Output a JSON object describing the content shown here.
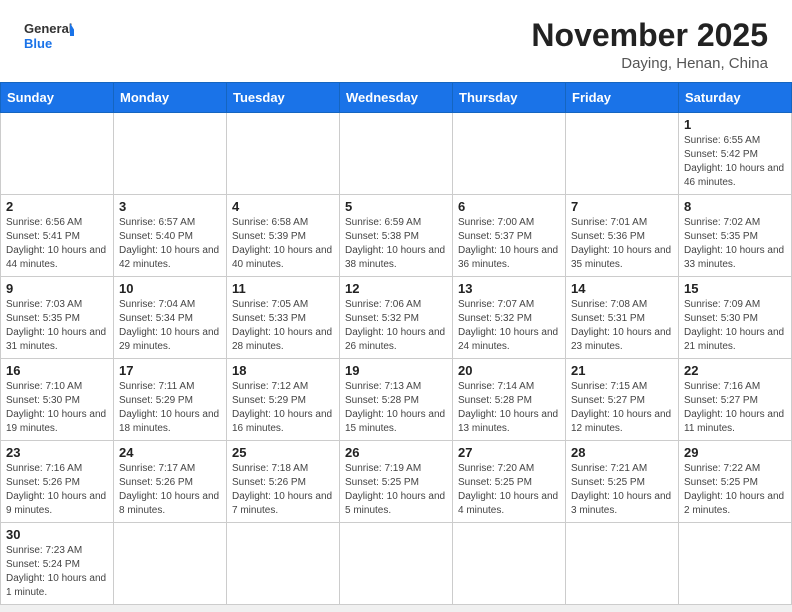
{
  "header": {
    "logo_general": "General",
    "logo_blue": "Blue",
    "month_title": "November 2025",
    "subtitle": "Daying, Henan, China"
  },
  "days_of_week": [
    "Sunday",
    "Monday",
    "Tuesday",
    "Wednesday",
    "Thursday",
    "Friday",
    "Saturday"
  ],
  "weeks": [
    [
      {
        "day": "",
        "info": ""
      },
      {
        "day": "",
        "info": ""
      },
      {
        "day": "",
        "info": ""
      },
      {
        "day": "",
        "info": ""
      },
      {
        "day": "",
        "info": ""
      },
      {
        "day": "",
        "info": ""
      },
      {
        "day": "1",
        "info": "Sunrise: 6:55 AM\nSunset: 5:42 PM\nDaylight: 10 hours and 46 minutes."
      }
    ],
    [
      {
        "day": "2",
        "info": "Sunrise: 6:56 AM\nSunset: 5:41 PM\nDaylight: 10 hours and 44 minutes."
      },
      {
        "day": "3",
        "info": "Sunrise: 6:57 AM\nSunset: 5:40 PM\nDaylight: 10 hours and 42 minutes."
      },
      {
        "day": "4",
        "info": "Sunrise: 6:58 AM\nSunset: 5:39 PM\nDaylight: 10 hours and 40 minutes."
      },
      {
        "day": "5",
        "info": "Sunrise: 6:59 AM\nSunset: 5:38 PM\nDaylight: 10 hours and 38 minutes."
      },
      {
        "day": "6",
        "info": "Sunrise: 7:00 AM\nSunset: 5:37 PM\nDaylight: 10 hours and 36 minutes."
      },
      {
        "day": "7",
        "info": "Sunrise: 7:01 AM\nSunset: 5:36 PM\nDaylight: 10 hours and 35 minutes."
      },
      {
        "day": "8",
        "info": "Sunrise: 7:02 AM\nSunset: 5:35 PM\nDaylight: 10 hours and 33 minutes."
      }
    ],
    [
      {
        "day": "9",
        "info": "Sunrise: 7:03 AM\nSunset: 5:35 PM\nDaylight: 10 hours and 31 minutes."
      },
      {
        "day": "10",
        "info": "Sunrise: 7:04 AM\nSunset: 5:34 PM\nDaylight: 10 hours and 29 minutes."
      },
      {
        "day": "11",
        "info": "Sunrise: 7:05 AM\nSunset: 5:33 PM\nDaylight: 10 hours and 28 minutes."
      },
      {
        "day": "12",
        "info": "Sunrise: 7:06 AM\nSunset: 5:32 PM\nDaylight: 10 hours and 26 minutes."
      },
      {
        "day": "13",
        "info": "Sunrise: 7:07 AM\nSunset: 5:32 PM\nDaylight: 10 hours and 24 minutes."
      },
      {
        "day": "14",
        "info": "Sunrise: 7:08 AM\nSunset: 5:31 PM\nDaylight: 10 hours and 23 minutes."
      },
      {
        "day": "15",
        "info": "Sunrise: 7:09 AM\nSunset: 5:30 PM\nDaylight: 10 hours and 21 minutes."
      }
    ],
    [
      {
        "day": "16",
        "info": "Sunrise: 7:10 AM\nSunset: 5:30 PM\nDaylight: 10 hours and 19 minutes."
      },
      {
        "day": "17",
        "info": "Sunrise: 7:11 AM\nSunset: 5:29 PM\nDaylight: 10 hours and 18 minutes."
      },
      {
        "day": "18",
        "info": "Sunrise: 7:12 AM\nSunset: 5:29 PM\nDaylight: 10 hours and 16 minutes."
      },
      {
        "day": "19",
        "info": "Sunrise: 7:13 AM\nSunset: 5:28 PM\nDaylight: 10 hours and 15 minutes."
      },
      {
        "day": "20",
        "info": "Sunrise: 7:14 AM\nSunset: 5:28 PM\nDaylight: 10 hours and 13 minutes."
      },
      {
        "day": "21",
        "info": "Sunrise: 7:15 AM\nSunset: 5:27 PM\nDaylight: 10 hours and 12 minutes."
      },
      {
        "day": "22",
        "info": "Sunrise: 7:16 AM\nSunset: 5:27 PM\nDaylight: 10 hours and 11 minutes."
      }
    ],
    [
      {
        "day": "23",
        "info": "Sunrise: 7:16 AM\nSunset: 5:26 PM\nDaylight: 10 hours and 9 minutes."
      },
      {
        "day": "24",
        "info": "Sunrise: 7:17 AM\nSunset: 5:26 PM\nDaylight: 10 hours and 8 minutes."
      },
      {
        "day": "25",
        "info": "Sunrise: 7:18 AM\nSunset: 5:26 PM\nDaylight: 10 hours and 7 minutes."
      },
      {
        "day": "26",
        "info": "Sunrise: 7:19 AM\nSunset: 5:25 PM\nDaylight: 10 hours and 5 minutes."
      },
      {
        "day": "27",
        "info": "Sunrise: 7:20 AM\nSunset: 5:25 PM\nDaylight: 10 hours and 4 minutes."
      },
      {
        "day": "28",
        "info": "Sunrise: 7:21 AM\nSunset: 5:25 PM\nDaylight: 10 hours and 3 minutes."
      },
      {
        "day": "29",
        "info": "Sunrise: 7:22 AM\nSunset: 5:25 PM\nDaylight: 10 hours and 2 minutes."
      }
    ],
    [
      {
        "day": "30",
        "info": "Sunrise: 7:23 AM\nSunset: 5:24 PM\nDaylight: 10 hours and 1 minute."
      },
      {
        "day": "",
        "info": ""
      },
      {
        "day": "",
        "info": ""
      },
      {
        "day": "",
        "info": ""
      },
      {
        "day": "",
        "info": ""
      },
      {
        "day": "",
        "info": ""
      },
      {
        "day": "",
        "info": ""
      }
    ]
  ]
}
